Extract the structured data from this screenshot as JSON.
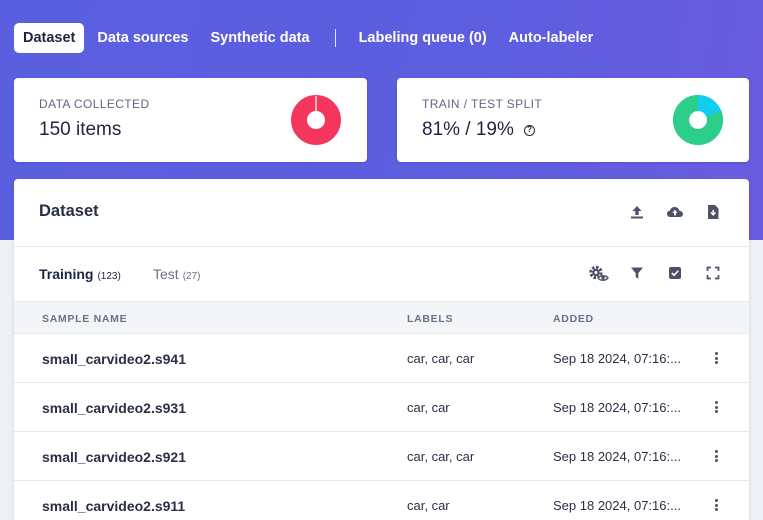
{
  "tabs": [
    {
      "label": "Dataset",
      "active": true
    },
    {
      "label": "Data sources",
      "active": false
    },
    {
      "label": "Synthetic data",
      "active": false
    },
    {
      "label": "Labeling queue (0)",
      "active": false
    },
    {
      "label": "Auto-labeler",
      "active": false
    }
  ],
  "stats": {
    "collected": {
      "label": "DATA COLLECTED",
      "value": "150 items",
      "color": "#f5365c"
    },
    "split": {
      "label": "TRAIN / TEST SPLIT",
      "value": "81% / 19%",
      "train_fraction": 0.81,
      "train_color": "#2dce89",
      "test_color": "#11cdef",
      "help_icon": "help-circle-icon"
    }
  },
  "dataset": {
    "title": "Dataset",
    "toolbar_icons": [
      "upload-icon",
      "cloud-upload-icon",
      "download-icon"
    ],
    "subtabs": {
      "training": {
        "label": "Training",
        "count": "(123)"
      },
      "test": {
        "label": "Test",
        "count": "(27)"
      }
    },
    "view_icons": [
      "settings-eye-icon",
      "filter-icon",
      "checkbox-icon",
      "fullscreen-icon"
    ],
    "columns": {
      "name": "SAMPLE NAME",
      "labels": "LABELS",
      "added": "ADDED"
    },
    "rows": [
      {
        "name": "small_carvideo2.s941",
        "labels": "car, car, car",
        "added": "Sep 18 2024, 07:16:..."
      },
      {
        "name": "small_carvideo2.s931",
        "labels": "car, car",
        "added": "Sep 18 2024, 07:16:..."
      },
      {
        "name": "small_carvideo2.s921",
        "labels": "car, car, car",
        "added": "Sep 18 2024, 07:16:..."
      },
      {
        "name": "small_carvideo2.s911",
        "labels": "car, car",
        "added": "Sep 18 2024, 07:16:..."
      }
    ]
  }
}
